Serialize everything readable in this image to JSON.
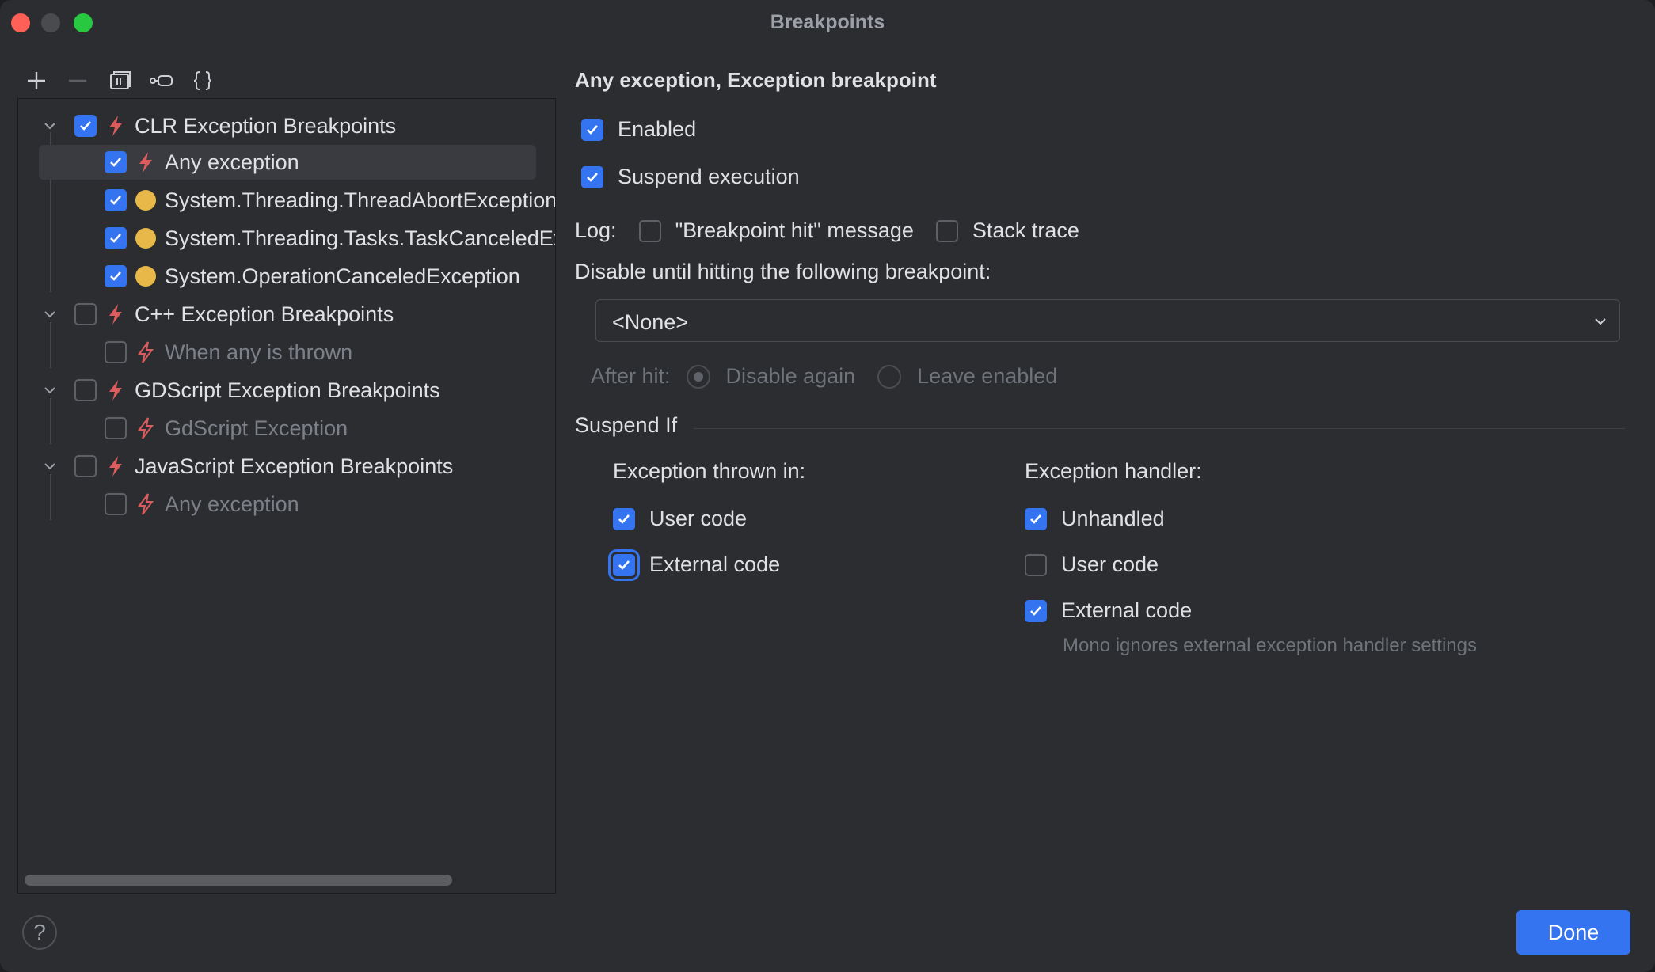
{
  "window": {
    "title": "Breakpoints"
  },
  "toolbar": {
    "icons": [
      "add-icon",
      "remove-icon",
      "group-icon",
      "exception-icon",
      "braces-icon"
    ]
  },
  "tree": {
    "groups": [
      {
        "label": "CLR Exception Breakpoints",
        "checked": true,
        "expanded": true,
        "items": [
          {
            "label": "Any exception",
            "checked": true,
            "icon": "lightning-icon",
            "selected": true
          },
          {
            "label": "System.Threading.ThreadAbortException",
            "checked": true,
            "icon": "yellow-dot-icon"
          },
          {
            "label": "System.Threading.Tasks.TaskCanceledException",
            "checked": true,
            "icon": "yellow-dot-icon"
          },
          {
            "label": "System.OperationCanceledException",
            "checked": true,
            "icon": "yellow-dot-icon"
          }
        ]
      },
      {
        "label": "C++ Exception Breakpoints",
        "checked": false,
        "expanded": true,
        "items": [
          {
            "label": "When any is thrown",
            "checked": false,
            "icon": "lightning-icon"
          }
        ]
      },
      {
        "label": "GDScript Exception Breakpoints",
        "checked": false,
        "expanded": true,
        "items": [
          {
            "label": "GdScript Exception",
            "checked": false,
            "icon": "lightning-icon"
          }
        ]
      },
      {
        "label": "JavaScript Exception Breakpoints",
        "checked": false,
        "expanded": true,
        "items": [
          {
            "label": "Any exception",
            "checked": false,
            "icon": "lightning-icon"
          }
        ]
      }
    ]
  },
  "details": {
    "title": "Any exception, Exception breakpoint",
    "enabled_label": "Enabled",
    "suspend_label": "Suspend execution",
    "log_label": "Log:",
    "log_message_label": "\"Breakpoint hit\" message",
    "stack_trace_label": "Stack trace",
    "disable_until_label": "Disable until hitting the following breakpoint:",
    "disable_until_value": "<None>",
    "after_hit_label": "After hit:",
    "disable_again_label": "Disable again",
    "leave_enabled_label": "Leave enabled",
    "suspend_if_label": "Suspend If",
    "thrown_in_label": "Exception thrown in:",
    "thrown_user_code": "User code",
    "thrown_external_code": "External code",
    "handler_label": "Exception handler:",
    "handler_unhandled": "Unhandled",
    "handler_user_code": "User code",
    "handler_external_code": "External code",
    "mono_note": "Mono ignores external exception handler settings"
  },
  "footer": {
    "help": "?",
    "done_label": "Done"
  },
  "colors": {
    "accent": "#3574f0",
    "lightning": "#db5c5c",
    "dot": "#e8b949",
    "background": "#2b2d30"
  }
}
